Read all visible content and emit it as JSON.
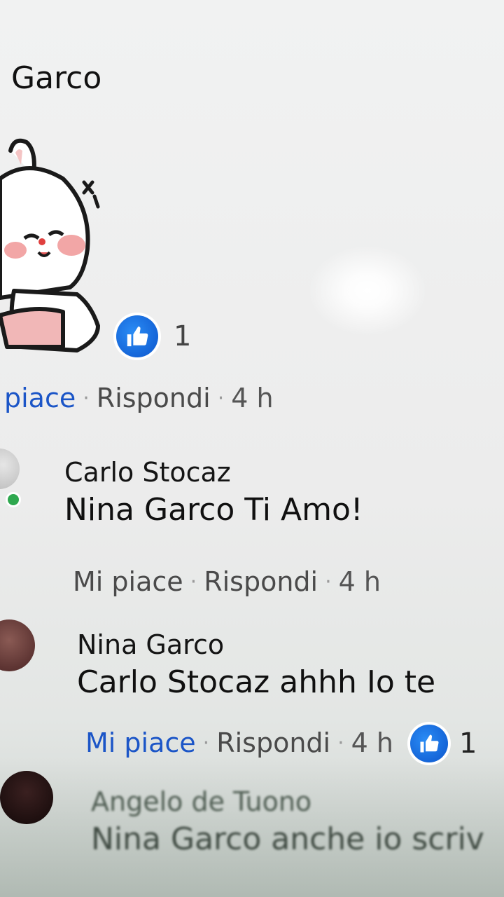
{
  "header": {
    "name": "Garco"
  },
  "sticker": {
    "reaction_count": "1"
  },
  "sticker_actions": {
    "like": "piace",
    "reply": "Rispondi",
    "time": "4 h"
  },
  "comments": [
    {
      "author": "Carlo Stocaz",
      "text": "Nina Garco Ti Amo!",
      "like": "Mi piace",
      "reply": "Rispondi",
      "time": "4 h"
    },
    {
      "author": "Nina Garco",
      "text": "Carlo Stocaz ahhh Io te",
      "like": "Mi piace",
      "reply": "Rispondi",
      "time": "4 h",
      "reaction_count": "1"
    },
    {
      "author": "Angelo de Tuono",
      "text": "Nina Garco anche io scriv"
    }
  ],
  "colors": {
    "like_blue": "#1b55c7",
    "reaction_blue": "#1565d8",
    "online_green": "#2fa84f"
  },
  "icons": [
    "thumbs-up-icon",
    "online-dot-icon"
  ]
}
